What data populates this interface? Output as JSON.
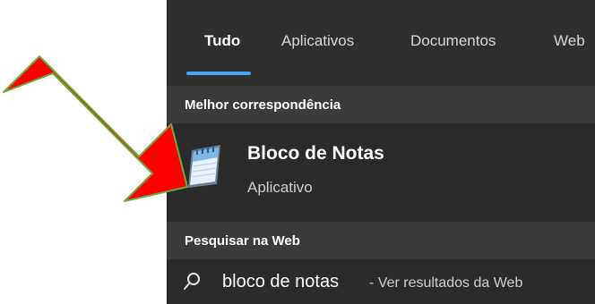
{
  "tabs": [
    {
      "label": "Tudo",
      "active": true
    },
    {
      "label": "Aplicativos",
      "active": false
    },
    {
      "label": "Documentos",
      "active": false
    },
    {
      "label": "Web",
      "active": false
    }
  ],
  "best_match": {
    "header": "Melhor correspondência",
    "title": "Bloco de Notas",
    "subtitle": "Aplicativo",
    "icon": "notepad-icon"
  },
  "web": {
    "header": "Pesquisar na Web",
    "query": "bloco de notas",
    "suffix": " - Ver resultados da Web",
    "icon": "search-icon"
  },
  "colors": {
    "accent": "#4aa3f2",
    "arrow_fill": "#ff0000",
    "arrow_stroke": "#6fa83a"
  }
}
